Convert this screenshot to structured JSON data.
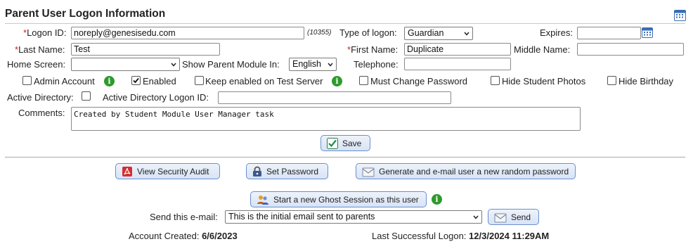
{
  "header": {
    "title": "Parent User Logon Information"
  },
  "form": {
    "logon_id": {
      "label": "Logon ID:",
      "required": "*",
      "value": "noreply@genesisedu.com",
      "id_note": "(10355)"
    },
    "type_of_logon": {
      "label": "Type of logon:",
      "value": "Guardian"
    },
    "expires": {
      "label": "Expires:",
      "value": ""
    },
    "last_name": {
      "label": "Last Name:",
      "required": "*",
      "value": "Test"
    },
    "first_name": {
      "label": "First Name:",
      "required": "*",
      "value": "Duplicate"
    },
    "middle_name": {
      "label": "Middle Name:",
      "value": ""
    },
    "home_screen": {
      "label": "Home Screen:",
      "value": ""
    },
    "show_parent_module_in": {
      "label": "Show Parent Module In:",
      "value": "English"
    },
    "telephone": {
      "label": "Telephone:",
      "value": ""
    },
    "checkboxes": {
      "admin_account": {
        "label": "Admin Account",
        "checked": false
      },
      "enabled": {
        "label": "Enabled",
        "checked": true
      },
      "keep_enabled_test": {
        "label": "Keep enabled on Test Server",
        "checked": false
      },
      "must_change_password": {
        "label": "Must Change Password",
        "checked": false
      },
      "hide_student_photos": {
        "label": "Hide Student Photos",
        "checked": false
      },
      "hide_birthday": {
        "label": "Hide Birthday",
        "checked": false
      }
    },
    "active_directory": {
      "label": "Active Directory:",
      "checked": false
    },
    "active_directory_logon_id": {
      "label": "Active Directory Logon ID:",
      "value": ""
    },
    "comments": {
      "label": "Comments:",
      "value": "Created by Student Module User Manager task"
    },
    "save_label": "Save"
  },
  "actions": {
    "view_security_audit": "View Security Audit",
    "set_password": "Set Password",
    "generate_password": "Generate and e-mail user a new random password",
    "ghost_session": "Start a new Ghost Session as this user"
  },
  "email": {
    "label": "Send this e-mail:",
    "selected": "This is the initial email sent to parents",
    "send_label": "Send"
  },
  "footer": {
    "account_created_label": "Account Created:",
    "account_created_value": "6/6/2023",
    "last_logon_label": "Last Successful Logon:",
    "last_logon_value": "12/3/2024 11:29AM"
  },
  "colors": {
    "accent": "#6a8fcf",
    "info_green": "#2e9a2e",
    "required_red": "#cc2222"
  },
  "icons": {
    "calendar": "calendar-icon",
    "pdf": "pdf-icon",
    "lock": "lock-icon",
    "mail": "mail-icon",
    "ghost": "users-icon",
    "info": "info-icon",
    "check": "check-icon"
  }
}
